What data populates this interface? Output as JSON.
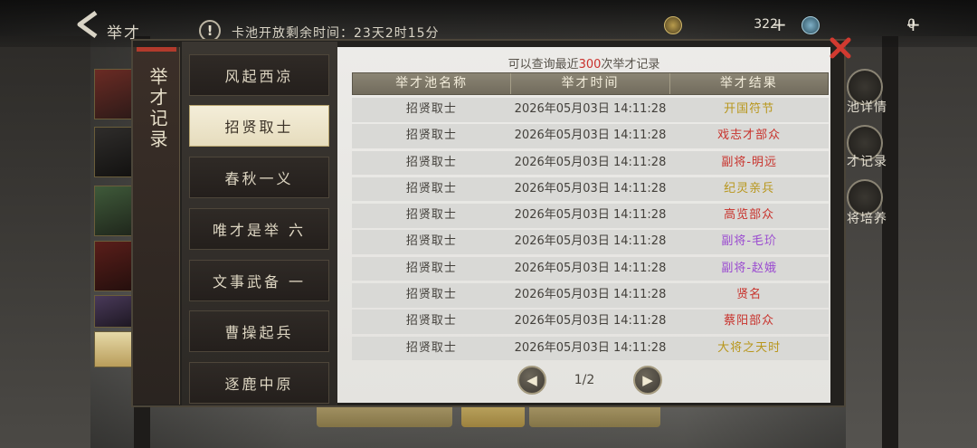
{
  "topbar": {
    "title": "举才",
    "pool_timer": "卡池开放剩余时间：23天2时15分",
    "currency_1": "322",
    "currency_2": "0"
  },
  "dialog": {
    "side_title": "举才记录",
    "tabs": [
      {
        "label": "风起西凉",
        "active": false
      },
      {
        "label": "招贤取士",
        "active": true
      },
      {
        "label": "春秋一义",
        "active": false
      },
      {
        "label": "唯才是举 六",
        "active": false
      },
      {
        "label": "文事武备 一",
        "active": false
      },
      {
        "label": "曹操起兵",
        "active": false
      },
      {
        "label": "逐鹿中原",
        "active": false
      }
    ],
    "tip_prefix": "可以查询最近",
    "tip_count": "300",
    "tip_suffix": "次举才记录",
    "columns": [
      "举才池名称",
      "举才时间",
      "举才结果"
    ],
    "records": [
      {
        "pool": "招贤取士",
        "time": "2026年05月03日 14:11:28",
        "result": "开国符节",
        "color": "#b8961c"
      },
      {
        "pool": "招贤取士",
        "time": "2026年05月03日 14:11:28",
        "result": "戏志才部众",
        "color": "#c8322c"
      },
      {
        "pool": "招贤取士",
        "time": "2026年05月03日 14:11:28",
        "result": "副将-明远",
        "color": "#c8322c"
      },
      {
        "pool": "招贤取士",
        "time": "2026年05月03日 14:11:28",
        "result": "纪灵亲兵",
        "color": "#b8961c"
      },
      {
        "pool": "招贤取士",
        "time": "2026年05月03日 14:11:28",
        "result": "高览部众",
        "color": "#c8322c"
      },
      {
        "pool": "招贤取士",
        "time": "2026年05月03日 14:11:28",
        "result": "副将-毛玠",
        "color": "#9a4ad0"
      },
      {
        "pool": "招贤取士",
        "time": "2026年05月03日 14:11:28",
        "result": "副将-赵娥",
        "color": "#9a4ad0"
      },
      {
        "pool": "招贤取士",
        "time": "2026年05月03日 14:11:28",
        "result": "贤名",
        "color": "#c8322c"
      },
      {
        "pool": "招贤取士",
        "time": "2026年05月03日 14:11:28",
        "result": "蔡阳部众",
        "color": "#c8322c"
      },
      {
        "pool": "招贤取士",
        "time": "2026年05月03日 14:11:28",
        "result": "大将之天时",
        "color": "#b8961c"
      }
    ],
    "page": "1/2"
  },
  "side_buttons": [
    "池详情",
    "才记录",
    "将培养"
  ]
}
